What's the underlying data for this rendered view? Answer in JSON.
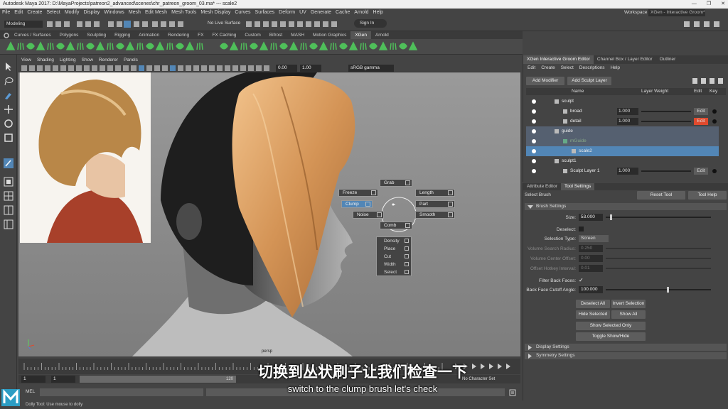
{
  "window": {
    "title": "Autodesk Maya 2017: D:\\MayaProjects\\patreon2_advanced\\scenes\\chr_patreon_groom_03.ma*  ---  scale2",
    "workspace_label": "Workspace :",
    "workspace_value": "XGen - Interactive Groom*"
  },
  "menubar": [
    "File",
    "Edit",
    "Create",
    "Select",
    "Modify",
    "Display",
    "Windows",
    "Mesh",
    "Edit Mesh",
    "Mesh Tools",
    "Mesh Display",
    "Curves",
    "Surfaces",
    "Deform",
    "UV",
    "Generate",
    "Cache",
    "Arnold",
    "Help"
  ],
  "statusline": {
    "mode": "Modeling",
    "live_surface": "No Live Surface",
    "sign_in": "Sign In"
  },
  "shelf_tabs": [
    "Curves / Surfaces",
    "Polygons",
    "Sculpting",
    "Rigging",
    "Animation",
    "Rendering",
    "FX",
    "FX Caching",
    "Custom",
    "Bifrost",
    "MASH",
    "Motion Graphics",
    "XGen",
    "Arnold"
  ],
  "shelf_active": "XGen",
  "viewport": {
    "menu": [
      "View",
      "Shading",
      "Lighting",
      "Show",
      "Renderer",
      "Panels"
    ],
    "field_a": "0.00",
    "field_b": "1.00",
    "colorspace": "sRGB gamma",
    "camera_label": "persp"
  },
  "marking_menu": {
    "items": [
      "Grab",
      "Freeze",
      "Length",
      "Clump",
      "Part",
      "Noise",
      "Smooth",
      "Comb"
    ],
    "active": "Clump",
    "list": [
      "Density",
      "Place",
      "Cut",
      "Width",
      "Select"
    ]
  },
  "xgen_panel": {
    "tabs": [
      "XGen Interactive Groom Editor",
      "Channel Box / Layer Editor",
      "Outliner"
    ],
    "menu": [
      "Edit",
      "Create",
      "Select",
      "Descriptions",
      "Help"
    ],
    "add_modifier": "Add Modifier",
    "add_sculpt_layer": "Add Sculpt Layer",
    "columns": [
      "Name",
      "Layer Weight",
      "Edit",
      "Key"
    ],
    "rows": [
      {
        "name": "sculpt",
        "weight": "",
        "edit": ""
      },
      {
        "name": "broad",
        "weight": "1.000",
        "edit": "Edit"
      },
      {
        "name": "detail",
        "weight": "1.000",
        "edit": "Edit"
      },
      {
        "name": "guide",
        "weight": "",
        "edit": ""
      },
      {
        "name": "mGuide",
        "weight": "",
        "edit": ""
      },
      {
        "name": "scale2",
        "weight": "",
        "edit": ""
      },
      {
        "name": "sculpt1",
        "weight": "",
        "edit": ""
      },
      {
        "name": "Sculpt Layer 1",
        "weight": "1.000",
        "edit": "Edit"
      }
    ]
  },
  "attr_panel": {
    "tabs": [
      "Attribute Editor",
      "Tool Settings"
    ],
    "tool_name": "Select Brush",
    "reset_tool": "Reset Tool",
    "tool_help": "Tool Help",
    "brush_settings": "Brush Settings",
    "size_label": "Size:",
    "size_value": "53.000",
    "deselect_label": "Deselect:",
    "selection_type_label": "Selection Type:",
    "selection_type_value": "Screen",
    "volume_search_label": "Volume Search Radius:",
    "volume_search_value": "0.250",
    "volume_center_label": "Volume Center Offset:",
    "volume_center_value": "0.00",
    "offset_hotkey_label": "Offset Hotkey Interval:",
    "offset_hotkey_value": "0.01",
    "filter_back_label": "Filter Back Faces:",
    "back_face_label": "Back Face Cutoff Angle:",
    "back_face_value": "100.000",
    "buttons": [
      "Deselect All",
      "Invert Selection",
      "Hide Selected",
      "Show All",
      "Show Selected Only",
      "Toggle Show/Hide"
    ],
    "display_settings": "Display Settings",
    "symmetry_settings": "Symmetry Settings"
  },
  "timeline": {
    "start": "1",
    "start2": "1",
    "end": "120",
    "character_set": "No Character Set"
  },
  "mel_label": "MEL",
  "helpline": "Dolly Tool: Use mouse to dolly",
  "subtitle": {
    "chinese": "切换到丛状刷子让我们检查一下",
    "english": "switch to the clump brush let's check"
  },
  "colors": {
    "accent_blue": "#5286b6",
    "edit_red": "#e04a2e",
    "shelf_green": "#4fbf5a"
  }
}
